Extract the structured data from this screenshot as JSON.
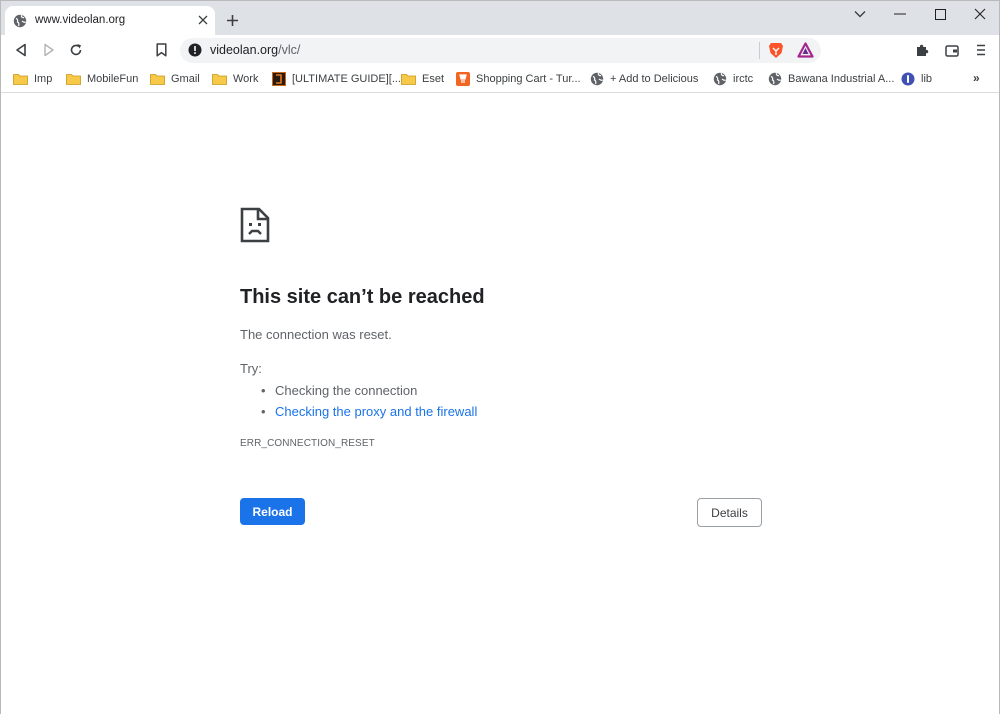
{
  "tab": {
    "title": "www.videolan.org",
    "close_glyph": "✕",
    "favicon": "globe-icon"
  },
  "newtab": {
    "glyph": "+"
  },
  "window_controls": {
    "tabsearch": "chevron-down-icon",
    "minimize": "minimize-icon",
    "maximize": "maximize-icon",
    "close": "close-icon"
  },
  "toolbar": {
    "back": "back-icon",
    "forward": "forward-icon",
    "reload": "reload-icon",
    "bookmark": "bookmark-icon"
  },
  "omnibox": {
    "host": "videolan.org",
    "path": "/vlc/",
    "info_icon": "info-icon"
  },
  "extensions": {
    "brave_shields": "brave-shield-icon",
    "brave_rewards": "brave-rewards-icon",
    "puzzle": "extensions-icon",
    "wallet": "wallet-icon",
    "menu": "menu-icon"
  },
  "bookmarks": [
    {
      "label": "Imp",
      "icon": "folder"
    },
    {
      "label": "MobileFun",
      "icon": "folder"
    },
    {
      "label": "Gmail",
      "icon": "folder"
    },
    {
      "label": "Work",
      "icon": "folder"
    },
    {
      "label": "[ULTIMATE GUIDE][...",
      "icon": "site"
    },
    {
      "label": "Eset",
      "icon": "folder"
    },
    {
      "label": "Shopping Cart - Tur...",
      "icon": "site-orange"
    },
    {
      "label": "+ Add to Delicious",
      "icon": "globe"
    },
    {
      "label": "irctc",
      "icon": "globe"
    },
    {
      "label": "Bawana Industrial A...",
      "icon": "globe"
    },
    {
      "label": "lib",
      "icon": "site-blue"
    }
  ],
  "bookmarks_more": "»",
  "error": {
    "headline": "This site can’t be reached",
    "subtext": "The connection was reset.",
    "try_label": "Try:",
    "suggestions": [
      "Checking the connection",
      "Checking the proxy and the firewall"
    ],
    "code": "ERR_CONNECTION_RESET",
    "reload_label": "Reload",
    "details_label": "Details"
  },
  "colors": {
    "accent": "#1a73e8",
    "folder": "#f7c948",
    "tabstrip": "#dee1e6"
  }
}
